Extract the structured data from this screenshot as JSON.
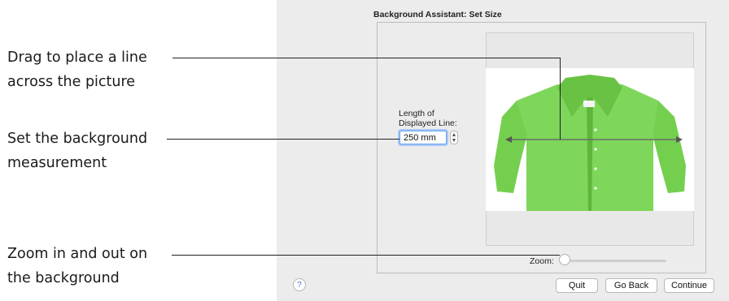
{
  "callouts": {
    "line1": "Drag to place a line",
    "line2": "across the picture",
    "measure1": "Set the background",
    "measure2": "measurement",
    "zoom1": "Zoom in and out on",
    "zoom2": "the background"
  },
  "dialog": {
    "title": "Background Assistant: Set Size",
    "length_label_line1": "Length of",
    "length_label_line2": "Displayed Line:",
    "length_value": "250 mm",
    "zoom_label": "Zoom:",
    "zoom_level": 0,
    "help_label": "?",
    "buttons": {
      "quit": "Quit",
      "go_back": "Go Back",
      "continue": "Continue"
    }
  },
  "colors": {
    "shirt": "#7ed65a",
    "focus_ring": "#6a9ff0",
    "dialog_bg": "#ececec"
  },
  "icons": {
    "stepper": "stepper-arrows-icon",
    "help": "help-icon",
    "shirt": "shirt-image"
  }
}
